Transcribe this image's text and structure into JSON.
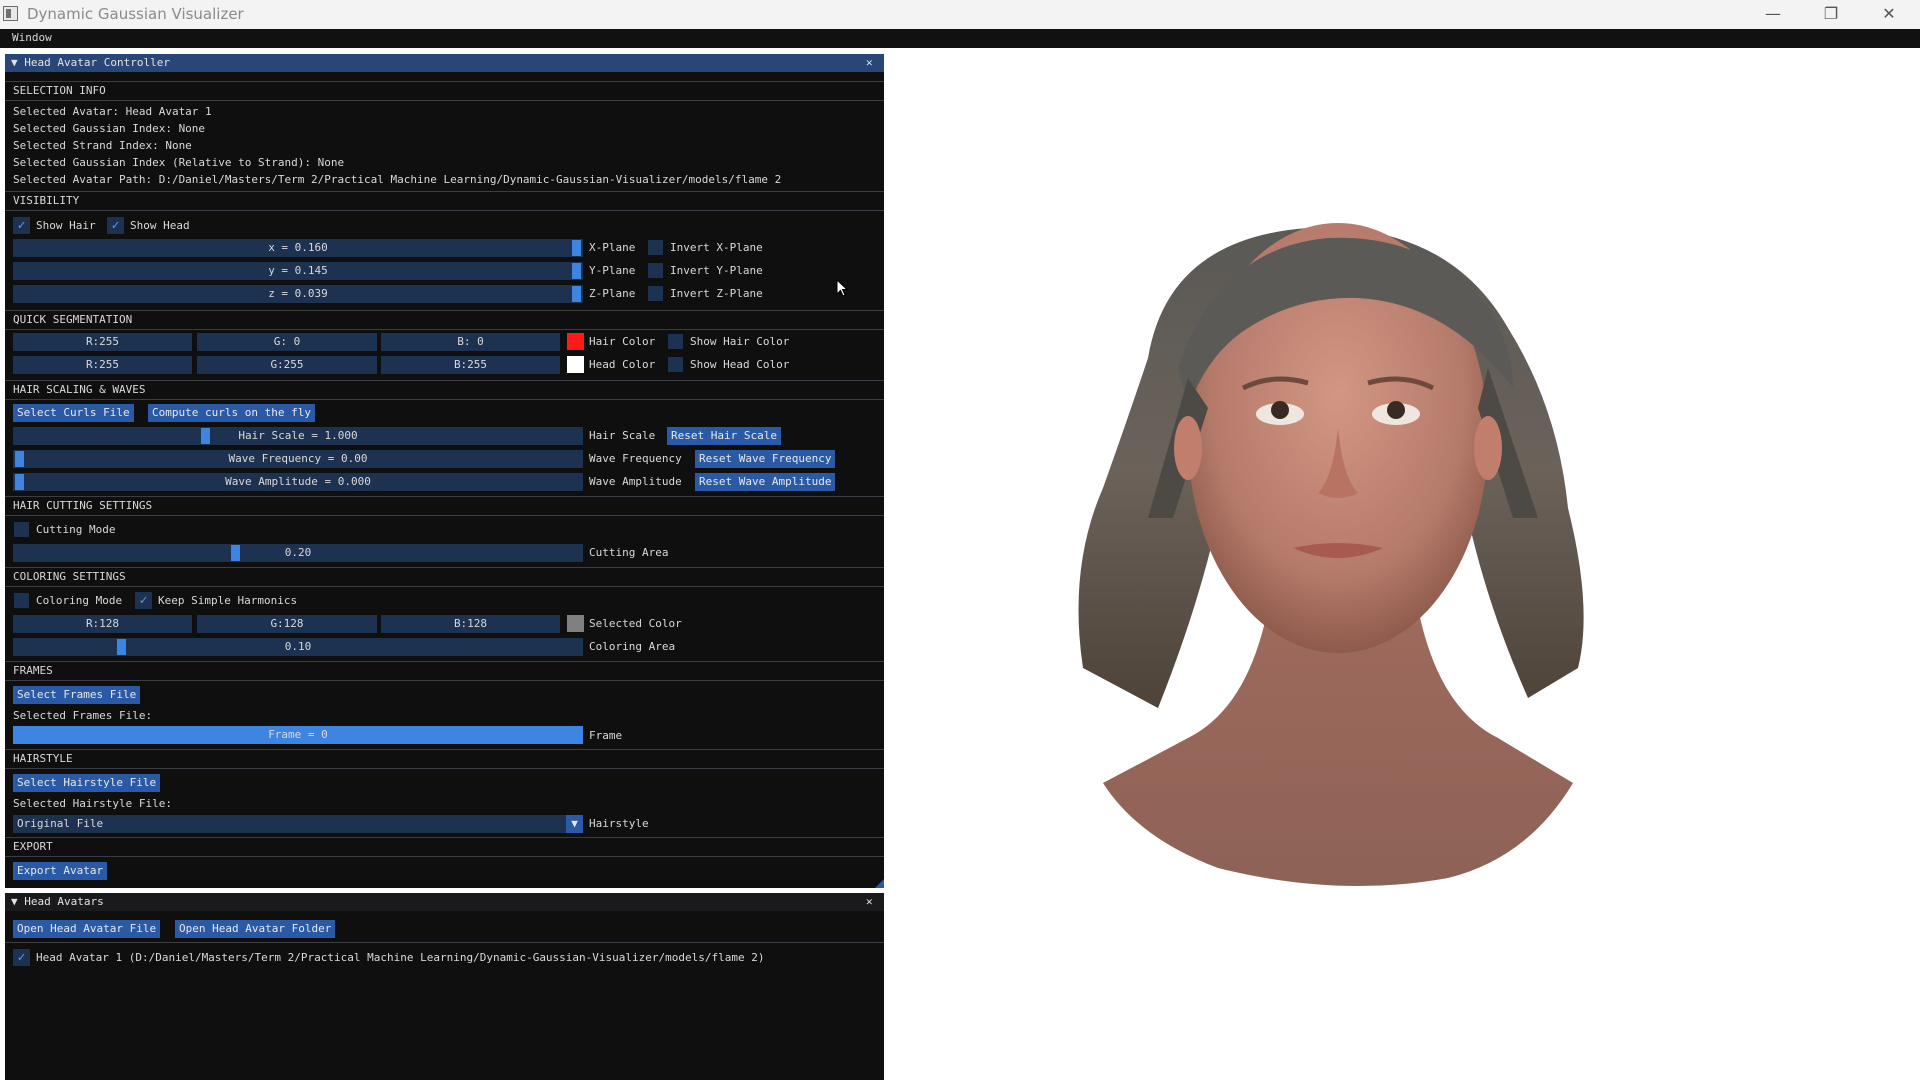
{
  "app": {
    "title": "Dynamic Gaussian Visualizer",
    "menu": "Window"
  },
  "window_controls": {
    "minimize": "—",
    "maximize": "❐",
    "close": "✕"
  },
  "controller": {
    "title": "▼ Head Avatar Controller",
    "close": "✕",
    "selection_info": {
      "header": "SELECTION INFO",
      "avatar": "Selected Avatar: Head Avatar 1",
      "gaussian_index": "Selected Gaussian Index: None",
      "strand_index": "Selected Strand Index: None",
      "gaussian_rel": "Selected Gaussian Index (Relative to Strand): None",
      "avatar_path": "Selected Avatar Path: D:/Daniel/Masters/Term 2/Practical Machine Learning/Dynamic-Gaussian-Visualizer/models/flame 2"
    },
    "visibility": {
      "header": "VISIBILITY",
      "show_hair": {
        "label": "Show Hair",
        "checked": true
      },
      "show_head": {
        "label": "Show Head",
        "checked": true
      },
      "planes": [
        {
          "value": "x = 0.160",
          "plane": "X-Plane",
          "invert": "Invert X-Plane",
          "fraction": 1.0
        },
        {
          "value": "y = 0.145",
          "plane": "Y-Plane",
          "invert": "Invert Y-Plane",
          "fraction": 1.0
        },
        {
          "value": "z = 0.039",
          "plane": "Z-Plane",
          "invert": "Invert Z-Plane",
          "fraction": 1.0
        }
      ]
    },
    "quick_segmentation": {
      "header": "QUICK SEGMENTATION",
      "hair": {
        "r": "R:255",
        "g": "G:  0",
        "b": "B:  0",
        "label": "Hair Color",
        "show": "Show Hair Color",
        "color": "#ff1a1a"
      },
      "head": {
        "r": "R:255",
        "g": "G:255",
        "b": "B:255",
        "label": "Head Color",
        "show": "Show Head Color",
        "color": "#ffffff"
      }
    },
    "hair_scaling": {
      "header": "HAIR SCALING & WAVES",
      "select_curls": "Select Curls File",
      "compute_curls": "Compute curls on the fly",
      "scale": {
        "value": "Hair Scale = 1.000",
        "label": "Hair Scale",
        "reset": "Reset Hair Scale",
        "fraction": 0.34
      },
      "freq": {
        "value": "Wave Frequency = 0.00",
        "label": "Wave Frequency",
        "reset": "Reset Wave Frequency",
        "fraction": 0.0
      },
      "amp": {
        "value": "Wave Amplitude = 0.000",
        "label": "Wave Amplitude",
        "reset": "Reset Wave Amplitude",
        "fraction": 0.0
      }
    },
    "hair_cutting": {
      "header": "HAIR CUTTING SETTINGS",
      "mode": {
        "label": "Cutting Mode",
        "checked": false
      },
      "area": {
        "value": "0.20",
        "label": "Cutting Area",
        "fraction": 0.4
      }
    },
    "coloring": {
      "header": "COLORING SETTINGS",
      "mode": {
        "label": "Coloring Mode",
        "checked": false
      },
      "keep_sh": {
        "label": "Keep Simple Harmonics",
        "checked": true
      },
      "r": "R:128",
      "g": "G:128",
      "b": "B:128",
      "selected_label": "Selected Color",
      "selected_color": "#808080",
      "area": {
        "value": "0.10",
        "label": "Coloring Area",
        "fraction": 0.19
      }
    },
    "frames": {
      "header": "FRAMES",
      "select": "Select Frames File",
      "selected": "Selected Frames File:",
      "frame": {
        "value": "Frame = 0",
        "label": "Frame"
      }
    },
    "hairstyle": {
      "header": "HAIRSTYLE",
      "select": "Select Hairstyle File",
      "selected": "Selected Hairstyle File:",
      "combo_value": "Original File",
      "combo_arrow": "▼",
      "label": "Hairstyle"
    },
    "export": {
      "header": "EXPORT",
      "button": "Export Avatar"
    }
  },
  "avatars_window": {
    "title": "▼ Head Avatars",
    "close": "✕",
    "open_file": "Open Head Avatar File",
    "open_folder": "Open Head Avatar Folder",
    "items": [
      {
        "label": "Head Avatar 1 (D:/Daniel/Masters/Term 2/Practical Machine Learning/Dynamic-Gaussian-Visualizer/models/flame 2)",
        "checked": true
      }
    ]
  },
  "check_glyph": "✓",
  "colors": {
    "accent": "#3d85e0",
    "title_bar": "#284677",
    "frame_bg": "#1d3150",
    "button": "#2a5aa5"
  }
}
